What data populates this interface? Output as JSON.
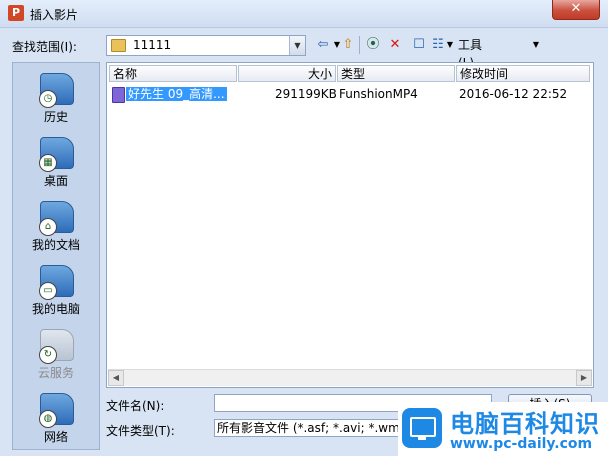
{
  "window": {
    "title": "插入影片",
    "close_glyph": "✕",
    "app_icon": "P"
  },
  "toolbar": {
    "look_in_label": "查找范围(I):",
    "look_in_value": "11111",
    "back_icon": "⇦",
    "up_icon": "⇧",
    "search_icon": "⦿",
    "delete_icon": "✕",
    "new_folder_icon": "☐",
    "views_icon": "☷",
    "tools_label": "工具(L)"
  },
  "places": [
    {
      "label": "历史",
      "icon": "history-icon",
      "sym": "◷"
    },
    {
      "label": "桌面",
      "icon": "desktop-icon",
      "sym": "▦"
    },
    {
      "label": "我的文档",
      "icon": "documents-icon",
      "sym": "⌂"
    },
    {
      "label": "我的电脑",
      "icon": "computer-icon",
      "sym": "▭"
    },
    {
      "label": "云服务",
      "icon": "cloud-icon",
      "sym": "↻"
    },
    {
      "label": "网络",
      "icon": "network-icon",
      "sym": "◍"
    }
  ],
  "file_list": {
    "columns": [
      "名称",
      "大小",
      "类型",
      "修改时间"
    ],
    "rows": [
      {
        "name": "好先生 09_高清...",
        "size": "291199KB",
        "type": "FunshionMP4",
        "modified": "2016-06-12 22:52"
      }
    ]
  },
  "form": {
    "filename_label": "文件名(N):",
    "filename_value": "",
    "filetype_label": "文件类型(T):",
    "filetype_value": "所有影音文件 (*.asf; *.avi; *.wmv",
    "insert_button": "插入(S)"
  },
  "watermark": {
    "title": "电脑百科知识",
    "url": "www.pc-daily.com"
  }
}
